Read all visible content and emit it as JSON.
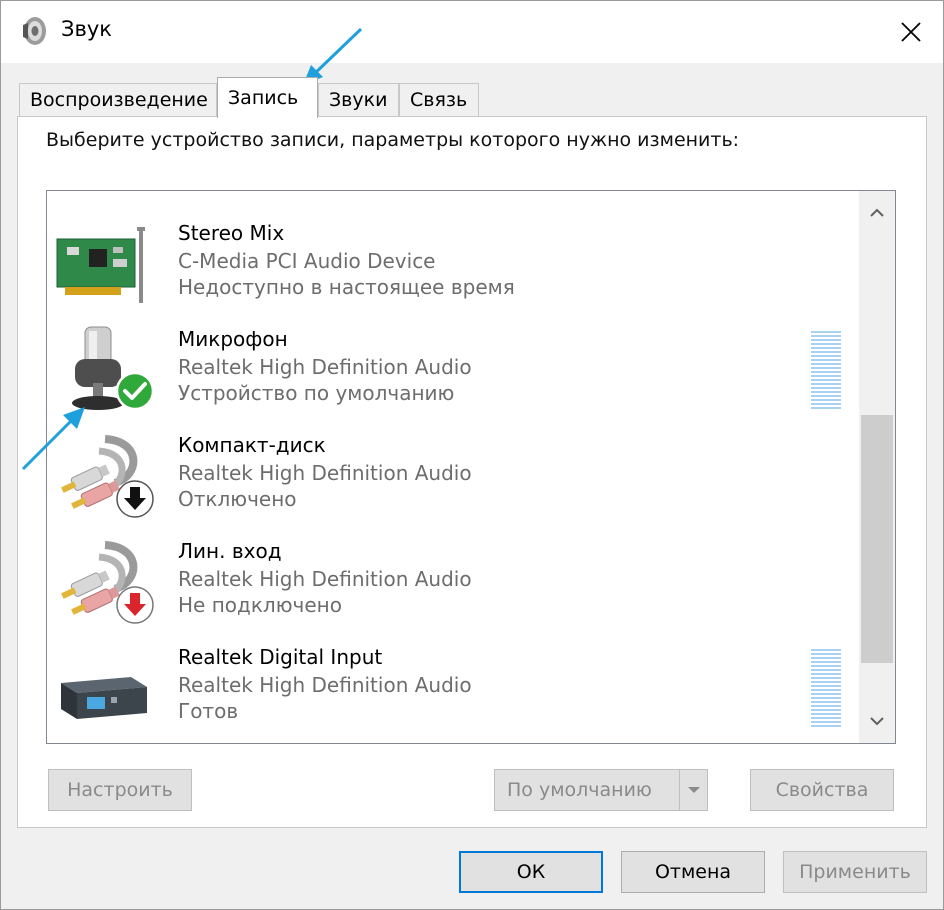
{
  "window": {
    "title": "Звук"
  },
  "tabs": [
    {
      "label": "Воспроизведение",
      "active": false
    },
    {
      "label": "Запись",
      "active": true
    },
    {
      "label": "Звуки",
      "active": false
    },
    {
      "label": "Связь",
      "active": false
    }
  ],
  "panel": {
    "instruction": "Выберите устройство записи, параметры которого нужно изменить:"
  },
  "devices": [
    {
      "name": "Stereo Mix",
      "driver": "C-Media PCI Audio Device",
      "status": "Недоступно в настоящее время",
      "icon": "sound-card-icon",
      "badge": ""
    },
    {
      "name": "Микрофон",
      "driver": "Realtek High Definition Audio",
      "status": "Устройство по умолчанию",
      "icon": "microphone-icon",
      "badge": "default-check-badge"
    },
    {
      "name": "Компакт-диск",
      "driver": "Realtek High Definition Audio",
      "status": "Отключено",
      "icon": "rca-cable-icon",
      "badge": "disabled-arrow-badge"
    },
    {
      "name": "Лин. вход",
      "driver": "Realtek High Definition Audio",
      "status": "Не подключено",
      "icon": "rca-cable-icon",
      "badge": "unplugged-arrow-badge"
    },
    {
      "name": "Realtek Digital Input",
      "driver": "Realtek High Definition Audio",
      "status": "Готов",
      "icon": "digital-input-box-icon",
      "badge": ""
    }
  ],
  "buttons": {
    "configure": "Настроить",
    "set_default": "По умолчанию",
    "properties": "Свойства",
    "ok": "ОК",
    "cancel": "Отмена",
    "apply": "Применить"
  },
  "colors": {
    "accent": "#0078d7",
    "annotation_arrow": "#1ea0dc",
    "check_badge": "#2fa93a",
    "unplugged_badge": "#d9252b",
    "level_meter": "#a9d2ee"
  }
}
